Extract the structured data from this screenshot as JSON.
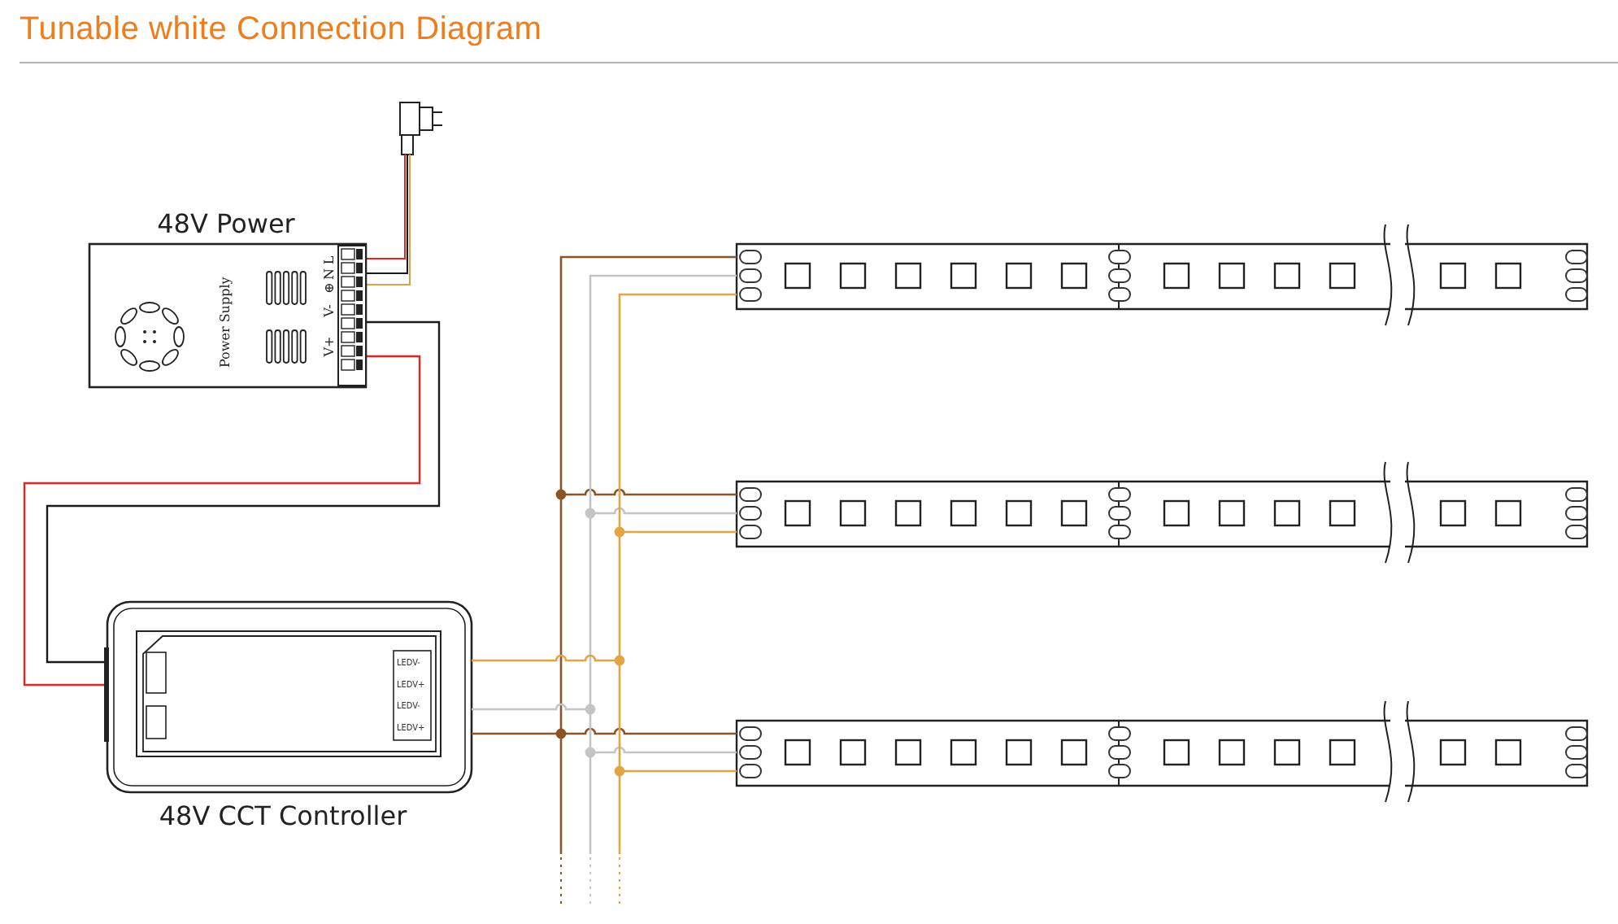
{
  "title": "Tunable white Connection Diagram",
  "power_supply": {
    "label": "48V Power",
    "body_text": "Power Supply",
    "input_terminals": [
      "L",
      "N",
      "⊕"
    ],
    "output_terminals": [
      "V-",
      "V+"
    ]
  },
  "controller": {
    "label": "48V CCT Controller",
    "terminals": [
      "LEDV-",
      "LEDV+",
      "LEDV-",
      "LEDV+"
    ]
  },
  "mains_wires": [
    {
      "color": "#e52421"
    },
    {
      "color": "#1a1a1a"
    },
    {
      "color": "#d9a14a"
    }
  ],
  "power_wires": [
    {
      "color": "#1a1a1a"
    },
    {
      "color": "#e52421"
    }
  ],
  "output_wires": [
    {
      "color": "#8a5328"
    },
    {
      "color": "#c4c4c4"
    },
    {
      "color": "#e3a544"
    }
  ],
  "strips": [
    {
      "kind": "led-strip"
    },
    {
      "kind": "led-strip"
    },
    {
      "kind": "led-strip"
    }
  ]
}
